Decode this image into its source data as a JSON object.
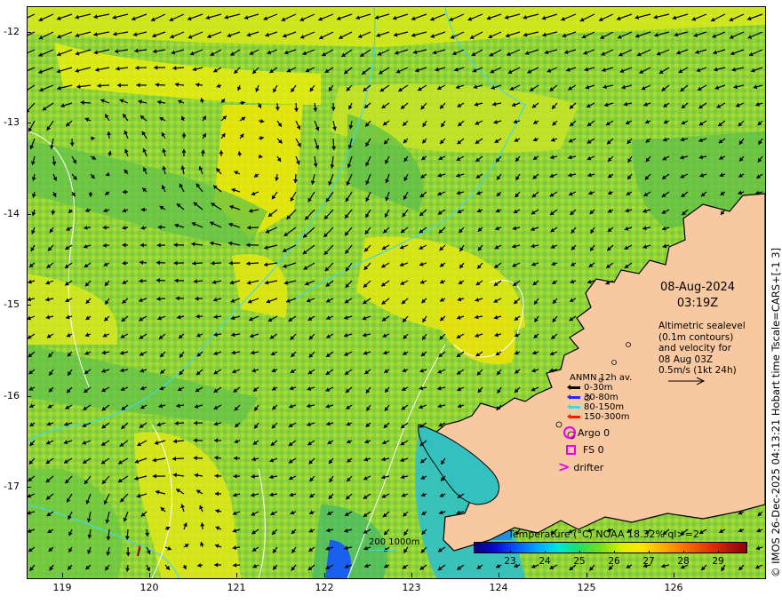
{
  "map": {
    "y_axis_labels": [
      "-12",
      "-13",
      "-14",
      "-15",
      "-16",
      "-17"
    ],
    "x_axis_labels": [
      "119",
      "120",
      "121",
      "122",
      "123",
      "124",
      "125",
      "126"
    ],
    "colors": {
      "land": "#f8c8a0",
      "coast": "#000000",
      "sea_mid": "#9ad63a",
      "contour_sealevel": "#ffffff",
      "isobath": "#40d8e8"
    }
  },
  "info": {
    "date": "08-Aug-2024",
    "time": "03:19Z",
    "altimetry_lines": [
      "Altimetric sealevel",
      "(0.1m contours)",
      "and velocity for",
      "08 Aug 03Z",
      "0.5m/s (1kt 24h)"
    ]
  },
  "anmn_legend": {
    "title": "ANMN 12h av.",
    "items": [
      {
        "label": "0-30m",
        "color": "#000000"
      },
      {
        "label": "30-80m",
        "color": "#1a2cff"
      },
      {
        "label": "80-150m",
        "color": "#40d8e8"
      },
      {
        "label": "150-300m",
        "color": "#ff1a00"
      }
    ]
  },
  "symbols": {
    "argo": "Argo 0",
    "fs": "FS 0",
    "drifter": "drifter",
    "drifter_glyph": ">"
  },
  "contours": {
    "label": "200  1000m"
  },
  "colorbar": {
    "title": "Temperature (°C) NOAA 18.32% ql>=2",
    "ticks": [
      "23",
      "24",
      "25",
      "26",
      "27",
      "28",
      "29"
    ]
  },
  "credit": "© IMOS 26-Dec-2025 04:13:21 Hobart time Tscale=CARS+[-1 3]"
}
